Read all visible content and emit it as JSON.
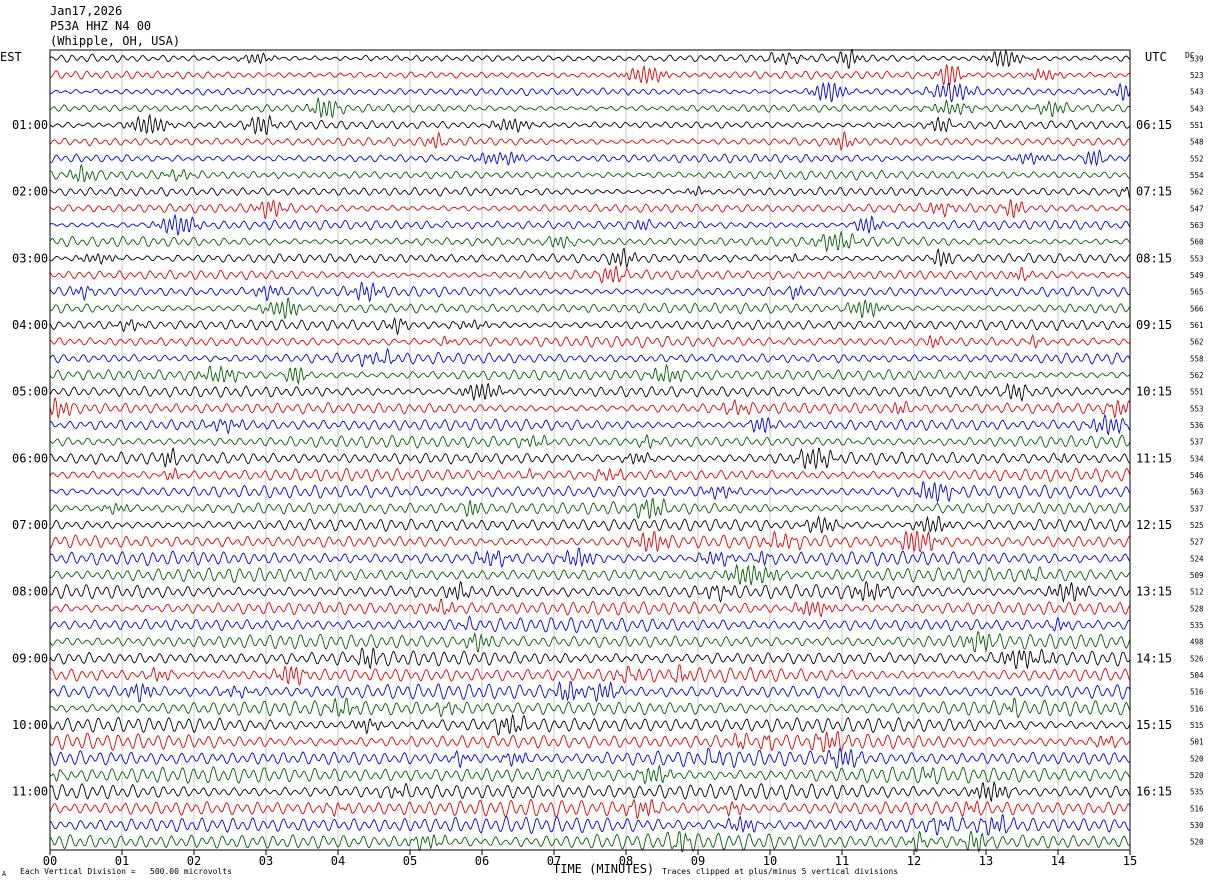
{
  "header": {
    "date": "Jan17,2026",
    "station": "P53A HHZ N4 00",
    "location": "(Whipple, OH, USA)"
  },
  "left_axis_title": "EST",
  "right_axis_title": "UTC",
  "dc_header": "DC",
  "footer": {
    "scale_note": "Each Vertical Division =   500.00 microvolts",
    "clip_note": "Traces clipped at plus/minus 5 vertical divisions",
    "corner_mark": "A"
  },
  "chart_data": {
    "type": "line",
    "title": "",
    "xlabel": "TIME (MINUTES)",
    "ylabel": "",
    "xlim": [
      0,
      15
    ],
    "x_ticks": [
      "00",
      "01",
      "02",
      "03",
      "04",
      "05",
      "06",
      "07",
      "08",
      "09",
      "10",
      "11",
      "12",
      "13",
      "14",
      "15"
    ],
    "left_time_labels": [
      "01:00",
      "02:00",
      "03:00",
      "04:00",
      "05:00",
      "06:00",
      "07:00",
      "08:00",
      "09:00",
      "10:00",
      "11:00"
    ],
    "right_time_labels": [
      "06:15",
      "07:15",
      "08:15",
      "09:15",
      "10:15",
      "11:15",
      "12:15",
      "13:15",
      "14:15",
      "15:15",
      "16:15"
    ],
    "trace_count": 48,
    "trace_colors": [
      "#000000",
      "#e00000",
      "#0000e0",
      "#006000"
    ],
    "dc_offsets": [
      539,
      523,
      543,
      543,
      551,
      548,
      552,
      554,
      562,
      547,
      563,
      560,
      553,
      549,
      565,
      566,
      561,
      562,
      558,
      562,
      551,
      553,
      536,
      537,
      534,
      546,
      563,
      537,
      525,
      527,
      524,
      509,
      512,
      528,
      535,
      498,
      526,
      504,
      516,
      516,
      515,
      501,
      520,
      520,
      535,
      516,
      530,
      520
    ],
    "grid": true
  }
}
